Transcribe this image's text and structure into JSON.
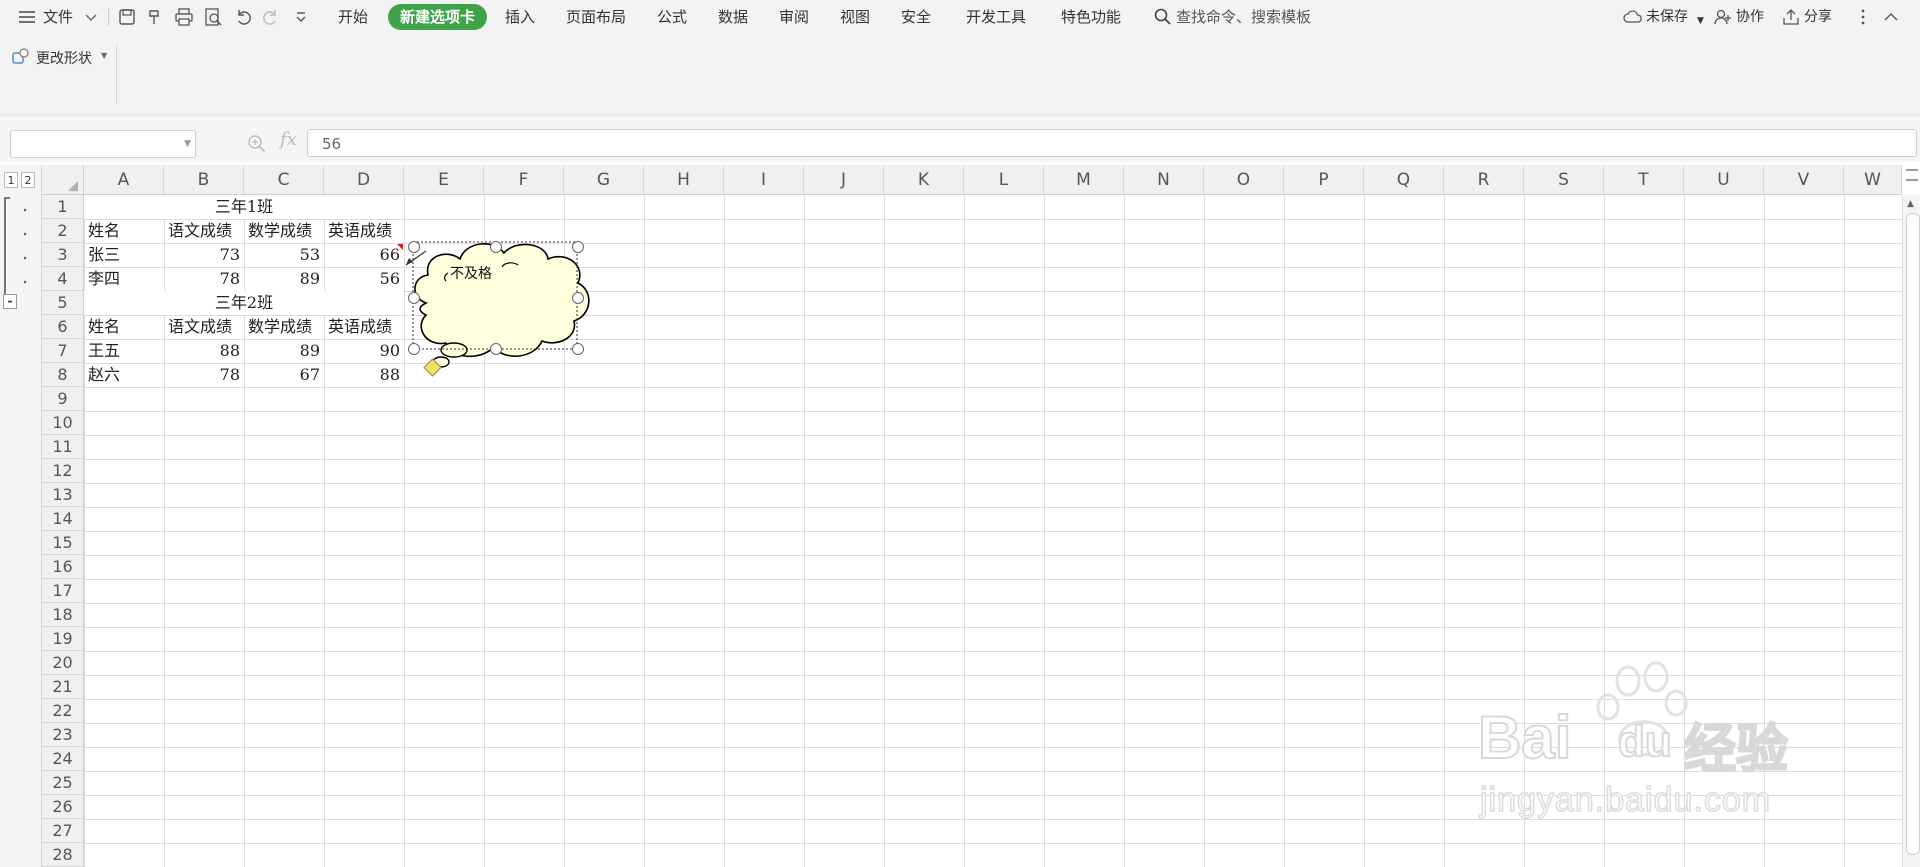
{
  "menubar": {
    "file_label": "文件",
    "tabs": [
      "开始",
      "新建选项卡",
      "插入",
      "页面布局",
      "公式",
      "数据",
      "审阅",
      "视图",
      "安全",
      "开发工具",
      "特色功能"
    ],
    "search_placeholder": "查找命令、搜索模板",
    "unsaved_label": "未保存",
    "collab_label": "协作",
    "share_label": "分享"
  },
  "ribbon": {
    "change_shape_label": "更改形状"
  },
  "formula_bar": {
    "name_box_value": "",
    "fx_label": "fx",
    "formula_value": "56"
  },
  "outline": {
    "levels": [
      "1",
      "2"
    ],
    "collapse_symbol": "-"
  },
  "columns": [
    "A",
    "B",
    "C",
    "D",
    "E",
    "F",
    "G",
    "H",
    "I",
    "J",
    "K",
    "L",
    "M",
    "N",
    "O",
    "P",
    "Q",
    "R",
    "S",
    "T",
    "U",
    "V",
    "W"
  ],
  "rows": [
    "1",
    "2",
    "3",
    "4",
    "5",
    "6",
    "7",
    "8",
    "9",
    "10",
    "11",
    "12",
    "13",
    "14",
    "15",
    "16",
    "17",
    "18",
    "19",
    "20",
    "21",
    "22",
    "23",
    "24",
    "25",
    "26",
    "27",
    "28"
  ],
  "sheet": {
    "title1": "三年1班",
    "headers1": [
      "姓名",
      "语文成绩",
      "数学成绩",
      "英语成绩"
    ],
    "r3": [
      "张三",
      "73",
      "53",
      "66"
    ],
    "r4": [
      "李四",
      "78",
      "89",
      "56"
    ],
    "title2": "三年2班",
    "headers2": [
      "姓名",
      "语文成绩",
      "数学成绩",
      "英语成绩"
    ],
    "r7": [
      "王五",
      "88",
      "89",
      "90"
    ],
    "r8": [
      "赵六",
      "78",
      "67",
      "88"
    ]
  },
  "callout": {
    "text": "不及格",
    "fill": "#ffffdd"
  },
  "watermark": {
    "brand_text": "Bai",
    "brand_text2": "du",
    "brand_cn": "经验",
    "url": "jingyan.baidu.com"
  },
  "colors": {
    "accent_green": "#3fa34a",
    "grid_line": "#dcdcdc"
  }
}
